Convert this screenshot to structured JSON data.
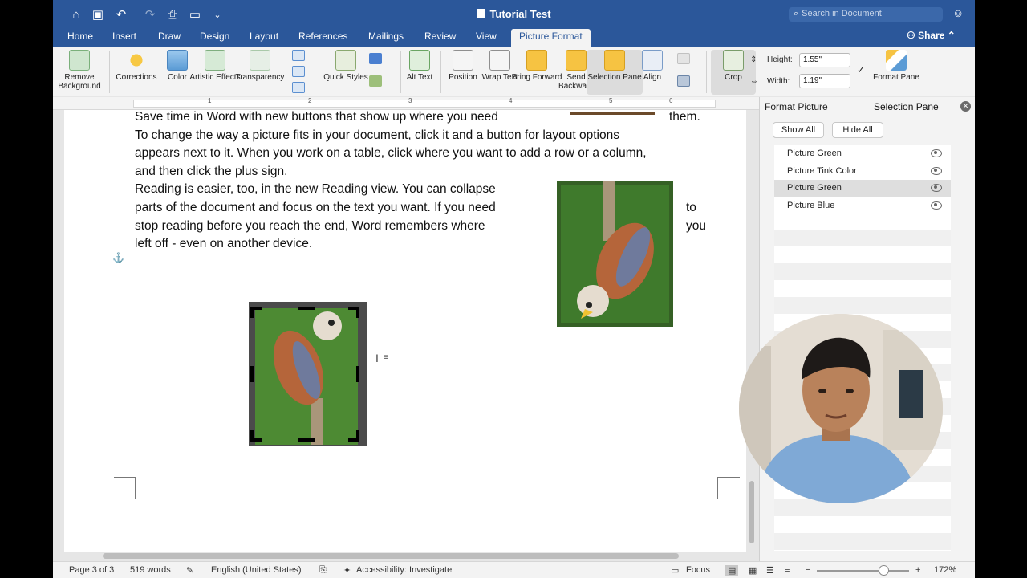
{
  "window": {
    "title": "Tutorial Test"
  },
  "search": {
    "placeholder": "Search in Document"
  },
  "tabs": [
    "Home",
    "Insert",
    "Draw",
    "Design",
    "Layout",
    "References",
    "Mailings",
    "Review",
    "View",
    "Picture Format"
  ],
  "share_label": "Share",
  "ribbon": {
    "remove_background": "Remove Background",
    "corrections": "Corrections",
    "color": "Color",
    "artistic_effects": "Artistic Effects",
    "transparency": "Transparency",
    "quick_styles": "Quick Styles",
    "alt_text": "Alt Text",
    "position": "Position",
    "wrap_text": "Wrap Text",
    "bring_forward": "Bring Forward",
    "send_backward": "Send Backward",
    "selection_pane": "Selection Pane",
    "align": "Align",
    "crop": "Crop",
    "height_label": "Height:",
    "height_value": "1.55\"",
    "width_label": "Width:",
    "width_value": "1.19\"",
    "format_pane": "Format Pane"
  },
  "ruler_numbers": [
    "1",
    "2",
    "3",
    "4",
    "5",
    "6"
  ],
  "document": {
    "lines": [
      "Save time in Word with new buttons that show up where you need",
      "To change the way a picture fits in your document, click it and a button for layout options",
      "appears next to it. When you work on a table, click where you want to add a row or a column,",
      "and then click the plus sign.",
      "Reading is easier, too, in the new Reading view. You can collapse",
      "parts of the document and focus on the text you want. If you need",
      "stop reading before you reach the end, Word remembers where",
      "left off - even on another device."
    ],
    "wrap_words": [
      "them.",
      "to",
      "you"
    ]
  },
  "pane": {
    "tab_format": "Format Picture",
    "tab_selection": "Selection Pane",
    "show_all": "Show All",
    "hide_all": "Hide All",
    "items": [
      "Picture Green",
      "Picture Tink Color",
      "Picture Green",
      "Picture Blue"
    ],
    "selected_index": 2
  },
  "status": {
    "page": "Page 3 of 3",
    "words": "519 words",
    "language": "English (United States)",
    "accessibility": "Accessibility: Investigate",
    "focus": "Focus",
    "zoom": "172%",
    "zoom_level": 0.72
  },
  "colors": {
    "title_bar": "#2b579a",
    "ribbon": "#f3f3f3",
    "page": "#ffffff"
  }
}
